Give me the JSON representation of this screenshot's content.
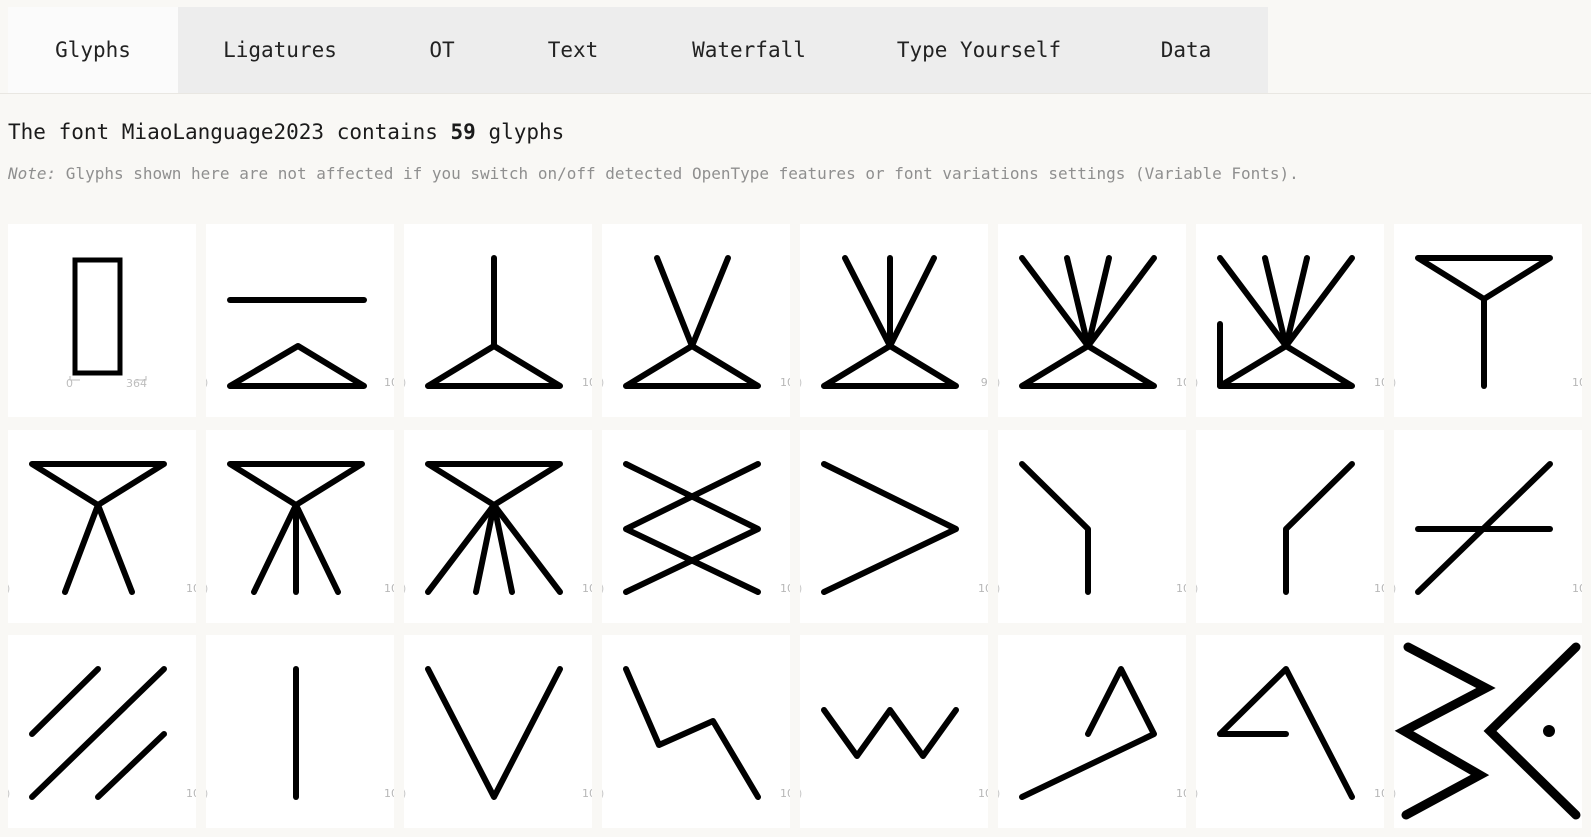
{
  "tabs": [
    "Glyphs",
    "Ligatures",
    "OT",
    "Text",
    "Waterfall",
    "Type Yourself",
    "Data"
  ],
  "active_tab": "Glyphs",
  "heading": {
    "prefix": "The font MiaoLanguage2023 contains ",
    "count": "59",
    "suffix": " glyphs"
  },
  "note": {
    "label": "Note:",
    "text": " Glyphs shown here are not affected if you switch on/off detected OpenType features or font variations settings (Variable Fonts)."
  },
  "glyphs": [
    {
      "name": "notdef-rectangle-glyph",
      "lsb": "0",
      "adv": "364",
      "metrics_style": "notdef"
    },
    {
      "name": "bar-over-triangle-glyph",
      "lsb": ")",
      "adv": "10"
    },
    {
      "name": "vertical-over-triangle-glyph",
      "lsb": ")",
      "adv": "10"
    },
    {
      "name": "v-over-triangle-glyph",
      "lsb": ")",
      "adv": "10"
    },
    {
      "name": "three-rays-over-triangle-glyph",
      "lsb": ")",
      "adv": "9("
    },
    {
      "name": "four-rays-over-triangle-glyph",
      "lsb": ")",
      "adv": "10"
    },
    {
      "name": "hooked-rays-over-triangle-glyph",
      "lsb": ")",
      "adv": "10"
    },
    {
      "name": "funnel-stem-glyph",
      "lsb": ")",
      "adv": "10"
    },
    {
      "name": "funnel-two-legs-glyph",
      "lsb": ")",
      "adv": "10"
    },
    {
      "name": "funnel-three-legs-glyph",
      "lsb": ")",
      "adv": "10"
    },
    {
      "name": "funnel-four-legs-glyph",
      "lsb": ")",
      "adv": "10"
    },
    {
      "name": "double-cross-glyph",
      "lsb": ")",
      "adv": "10"
    },
    {
      "name": "greater-than-glyph",
      "lsb": ")",
      "adv": "10"
    },
    {
      "name": "left-bent-stem-glyph",
      "lsb": ")",
      "adv": "10"
    },
    {
      "name": "right-bent-stem-glyph",
      "lsb": ")",
      "adv": "10"
    },
    {
      "name": "crossed-slash-glyph",
      "lsb": ")",
      "adv": "10"
    },
    {
      "name": "three-slashes-glyph",
      "lsb": ")",
      "adv": "10"
    },
    {
      "name": "vertical-stroke-glyph",
      "lsb": ")",
      "adv": "10"
    },
    {
      "name": "v-shape-glyph",
      "lsb": ")",
      "adv": "10"
    },
    {
      "name": "lightning-glyph",
      "lsb": ")",
      "adv": "10"
    },
    {
      "name": "w-shape-glyph",
      "lsb": ")",
      "adv": "10"
    },
    {
      "name": "slanted-flag-glyph",
      "lsb": ")",
      "adv": "10"
    },
    {
      "name": "open-a-glyph",
      "lsb": ")",
      "adv": "10"
    },
    {
      "name": "zigzag-chevron-dot-glyph",
      "lsb": ")",
      "adv": ""
    }
  ]
}
